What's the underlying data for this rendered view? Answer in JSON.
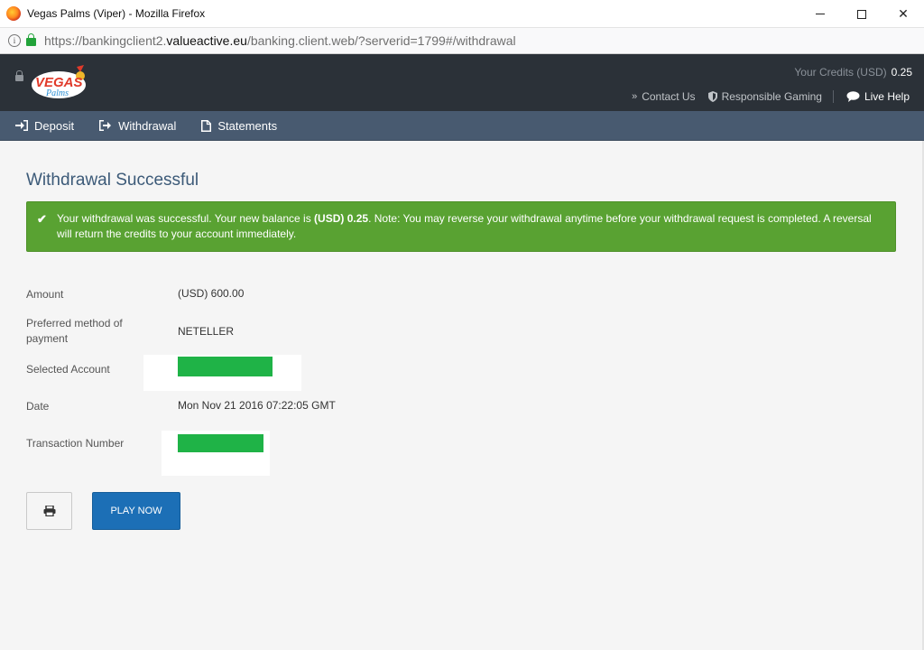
{
  "window": {
    "title": "Vegas Palms (Viper) - Mozilla Firefox",
    "minimize_glyph": "",
    "close_glyph": "✕"
  },
  "addressbar": {
    "url_prefix": "https://bankingclient2.",
    "url_domain": "valueactive.eu",
    "url_suffix": "/banking.client.web/?serverid=1799#/withdrawal",
    "info_glyph": "i"
  },
  "header": {
    "logo_text": "VEGAS",
    "logo_sub": "Palms",
    "credits_label": "Your Credits (USD)",
    "credits_value": "0.25",
    "links": {
      "contact": "Contact Us",
      "responsible": "Responsible Gaming",
      "live_help": "Live Help"
    }
  },
  "nav": {
    "deposit": "Deposit",
    "withdrawal": "Withdrawal",
    "statements": "Statements"
  },
  "main": {
    "title": "Withdrawal Successful",
    "alert": {
      "check_glyph": "✔",
      "text_before": "Your withdrawal was successful. Your new balance is ",
      "balance": "(USD) 0.25",
      "text_after": ". Note: You may reverse your withdrawal anytime before your withdrawal request is completed. A reversal will return the credits to your account immediately."
    },
    "details": {
      "amount_label": "Amount",
      "amount_value": "(USD) 600.00",
      "method_label": "Preferred method of payment",
      "method_value": "NETELLER",
      "account_label": "Selected Account",
      "date_label": "Date",
      "date_value": "Mon Nov 21 2016 07:22:05 GMT",
      "txn_label": "Transaction Number"
    },
    "buttons": {
      "play_now": "PLAY NOW"
    }
  },
  "colors": {
    "header_bg": "#2b3138",
    "nav_bg": "#485a70",
    "alert_bg": "#59a232",
    "play_button": "#1c6fb6",
    "title_color": "#3c5a78",
    "redaction": "#1fb347"
  },
  "icons": {
    "browser": "firefox-icon",
    "info": "info-icon",
    "secure": "lock-icon",
    "contact": "double-chevron-icon",
    "responsible": "shield-icon",
    "live_help": "chat-bubble-icon",
    "deposit": "sign-in-icon",
    "withdrawal": "sign-out-icon",
    "statements": "document-icon",
    "print": "printer-icon",
    "success": "check-icon"
  }
}
